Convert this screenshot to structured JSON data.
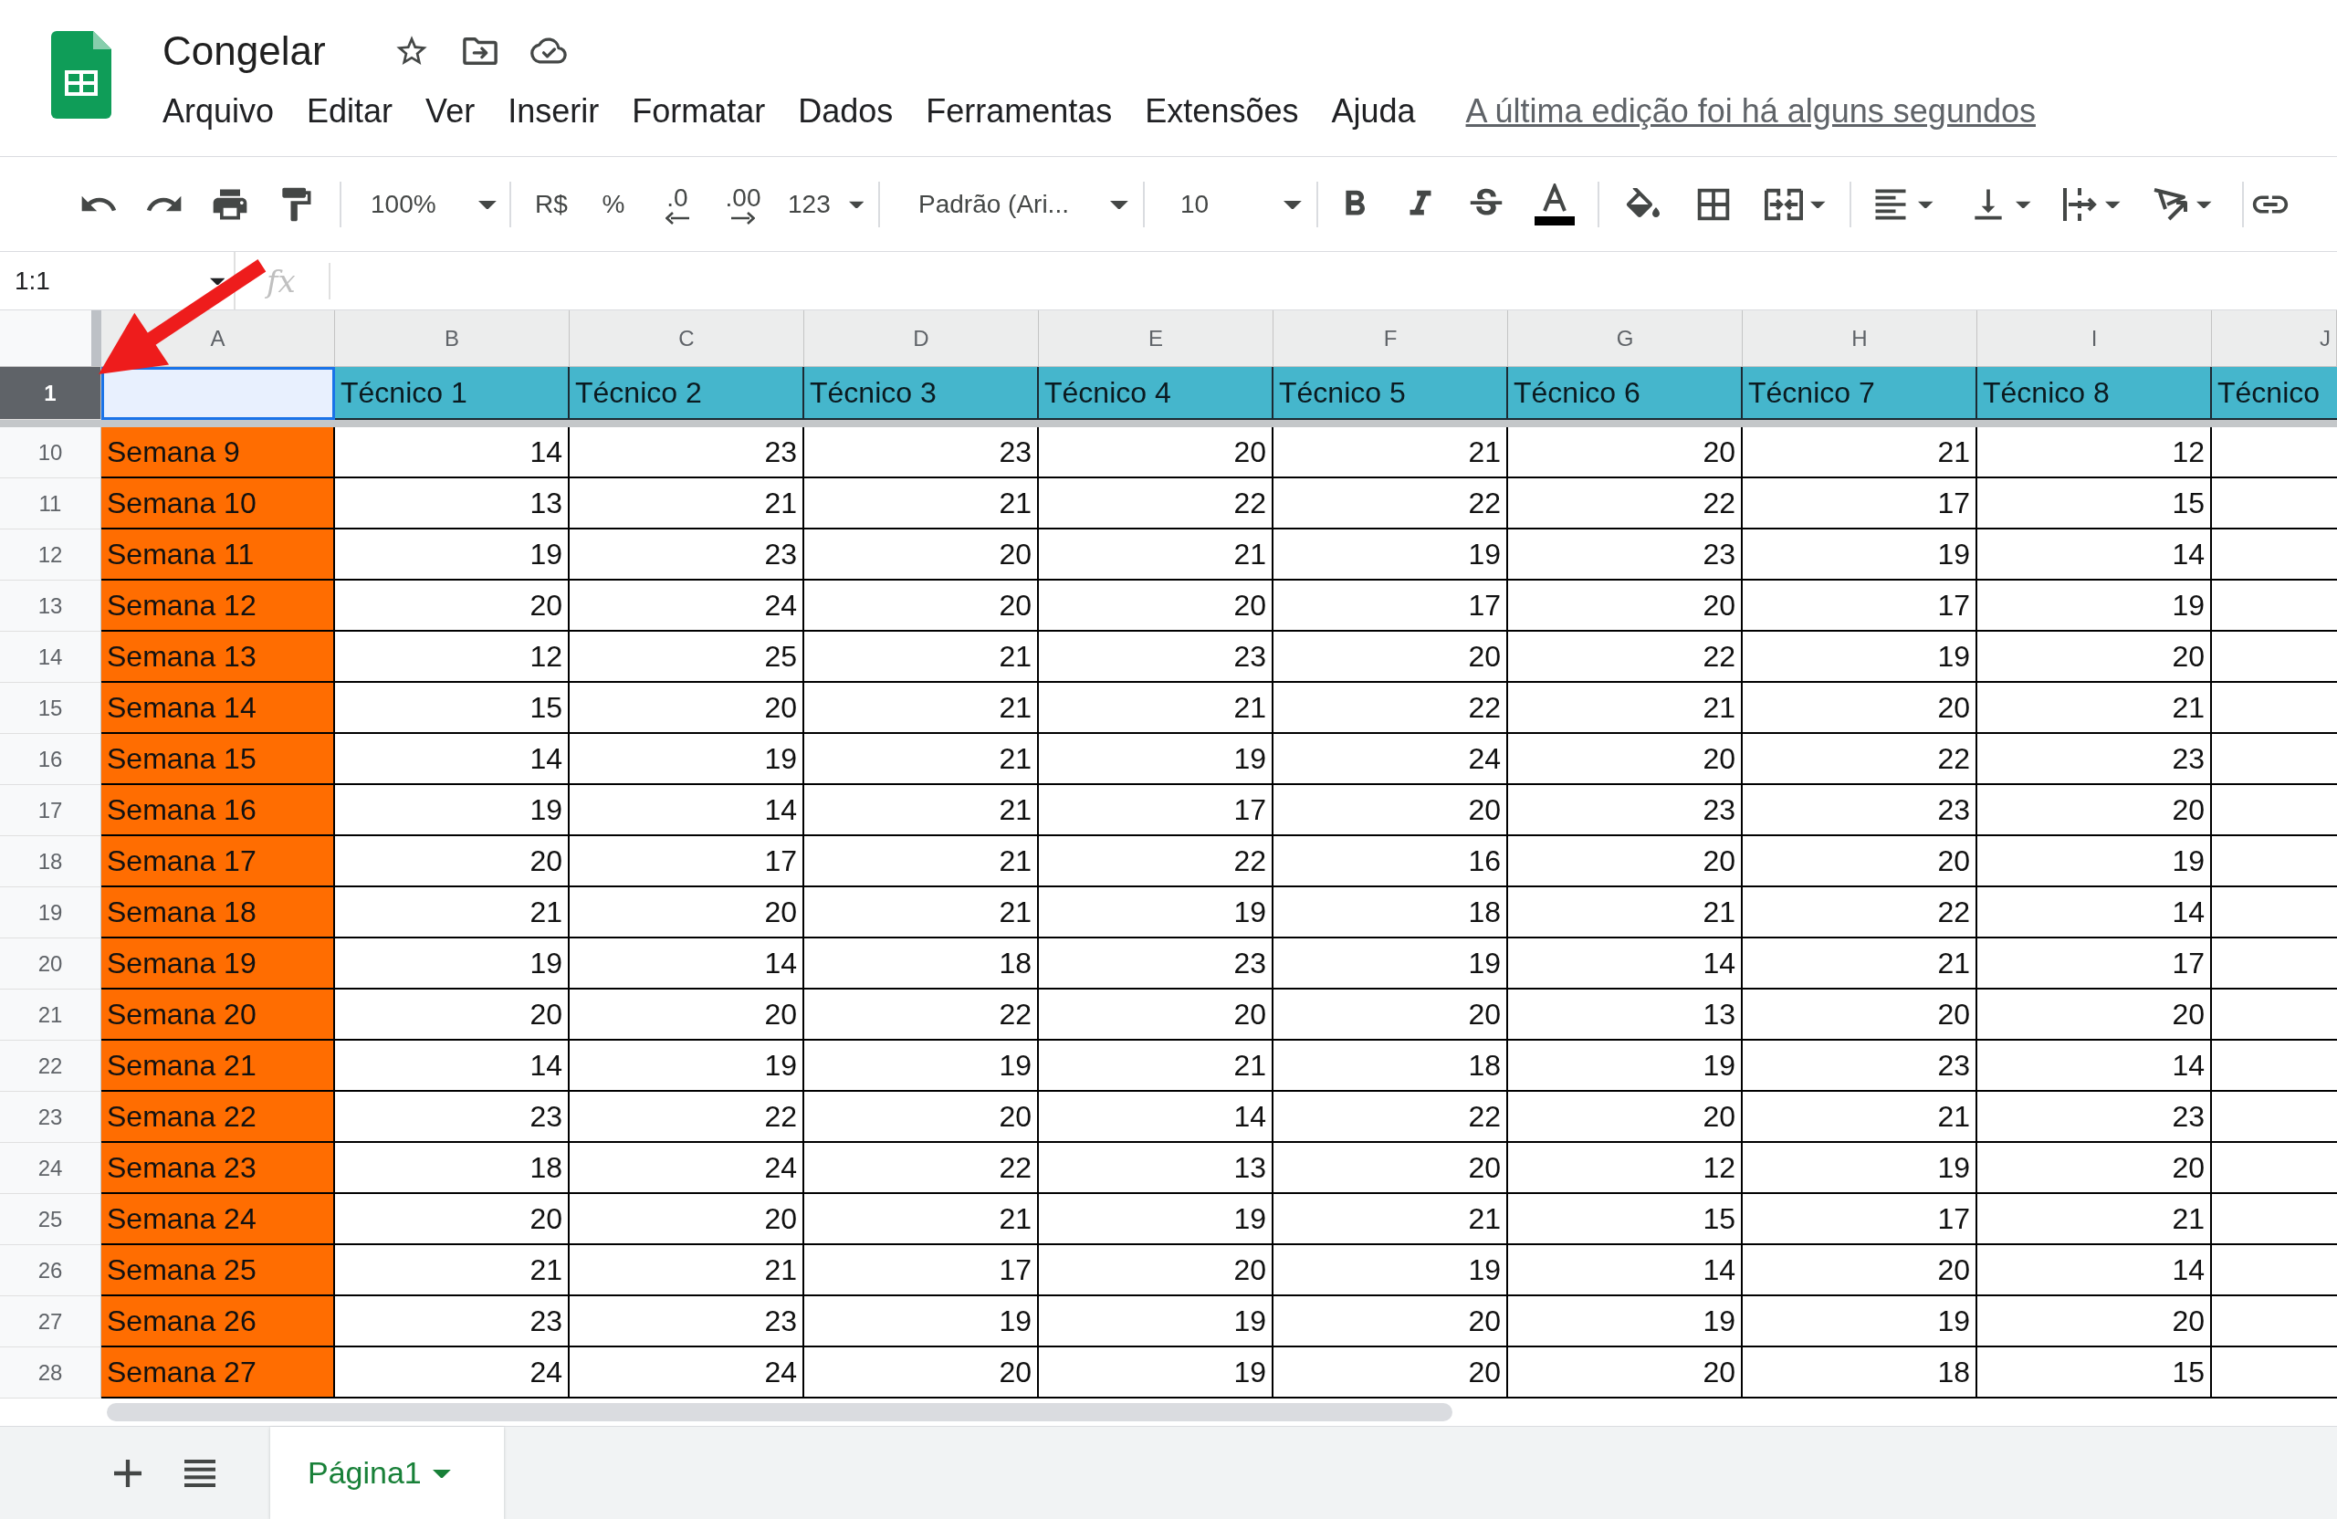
{
  "document": {
    "title": "Congelar",
    "menu": [
      "Arquivo",
      "Editar",
      "Ver",
      "Inserir",
      "Formatar",
      "Dados",
      "Ferramentas",
      "Extensões",
      "Ajuda"
    ],
    "last_edit": "A última edição foi há alguns segundos"
  },
  "toolbar": {
    "zoom": "100%",
    "currency": "R$",
    "percent": "%",
    "decrease_decimals": ".0",
    "increase_decimals": ".00",
    "more_formats": "123",
    "font": "Padrão (Ari...",
    "font_size": "10"
  },
  "formula_bar": {
    "name_box": "1:1",
    "function_label": "fx"
  },
  "grid": {
    "columns": [
      "A",
      "B",
      "C",
      "D",
      "E",
      "F",
      "G",
      "H",
      "I",
      "J"
    ],
    "frozen_row": {
      "number": "1",
      "selected": true,
      "cells": [
        {
          "active": true
        },
        {
          "text": "Técnico 1",
          "active": false
        },
        {
          "text": "Técnico 2",
          "active": false
        },
        {
          "text": "Técnico 3",
          "active": false
        },
        {
          "text": "Técnico 4",
          "active": false
        },
        {
          "text": "Técnico 5",
          "active": false
        },
        {
          "text": "Técnico 6",
          "active": false
        },
        {
          "text": "Técnico 7",
          "active": false
        },
        {
          "text": "Técnico 8",
          "active": false
        },
        {
          "text": "Técnico",
          "active": false
        }
      ]
    },
    "rows": [
      {
        "number": "10",
        "selected": false,
        "week": "Semana 9",
        "values": [
          "14",
          "23",
          "23",
          "20",
          "21",
          "20",
          "21",
          "12"
        ]
      },
      {
        "number": "11",
        "selected": false,
        "week": "Semana 10",
        "values": [
          "13",
          "21",
          "21",
          "22",
          "22",
          "22",
          "17",
          "15"
        ]
      },
      {
        "number": "12",
        "selected": false,
        "week": "Semana 11",
        "values": [
          "19",
          "23",
          "20",
          "21",
          "19",
          "23",
          "19",
          "14"
        ]
      },
      {
        "number": "13",
        "selected": false,
        "week": "Semana 12",
        "values": [
          "20",
          "24",
          "20",
          "20",
          "17",
          "20",
          "17",
          "19"
        ]
      },
      {
        "number": "14",
        "selected": false,
        "week": "Semana 13",
        "values": [
          "12",
          "25",
          "21",
          "23",
          "20",
          "22",
          "19",
          "20"
        ]
      },
      {
        "number": "15",
        "selected": false,
        "week": "Semana 14",
        "values": [
          "15",
          "20",
          "21",
          "21",
          "22",
          "21",
          "20",
          "21"
        ]
      },
      {
        "number": "16",
        "selected": false,
        "week": "Semana 15",
        "values": [
          "14",
          "19",
          "21",
          "19",
          "24",
          "20",
          "22",
          "23"
        ]
      },
      {
        "number": "17",
        "selected": false,
        "week": "Semana 16",
        "values": [
          "19",
          "14",
          "21",
          "17",
          "20",
          "23",
          "23",
          "20"
        ]
      },
      {
        "number": "18",
        "selected": false,
        "week": "Semana 17",
        "values": [
          "20",
          "17",
          "21",
          "22",
          "16",
          "20",
          "20",
          "19"
        ]
      },
      {
        "number": "19",
        "selected": false,
        "week": "Semana 18",
        "values": [
          "21",
          "20",
          "21",
          "19",
          "18",
          "21",
          "22",
          "14"
        ]
      },
      {
        "number": "20",
        "selected": false,
        "week": "Semana 19",
        "values": [
          "19",
          "14",
          "18",
          "23",
          "19",
          "14",
          "21",
          "17"
        ]
      },
      {
        "number": "21",
        "selected": false,
        "week": "Semana 20",
        "values": [
          "20",
          "20",
          "22",
          "20",
          "20",
          "13",
          "20",
          "20"
        ]
      },
      {
        "number": "22",
        "selected": false,
        "week": "Semana 21",
        "values": [
          "14",
          "19",
          "19",
          "21",
          "18",
          "19",
          "23",
          "14"
        ]
      },
      {
        "number": "23",
        "selected": false,
        "week": "Semana 22",
        "values": [
          "23",
          "22",
          "20",
          "14",
          "22",
          "20",
          "21",
          "23"
        ]
      },
      {
        "number": "24",
        "selected": false,
        "week": "Semana 23",
        "values": [
          "18",
          "24",
          "22",
          "13",
          "20",
          "12",
          "19",
          "20"
        ]
      },
      {
        "number": "25",
        "selected": false,
        "week": "Semana 24",
        "values": [
          "20",
          "20",
          "21",
          "19",
          "21",
          "15",
          "17",
          "21"
        ]
      },
      {
        "number": "26",
        "selected": false,
        "week": "Semana 25",
        "values": [
          "21",
          "21",
          "17",
          "20",
          "19",
          "14",
          "20",
          "14"
        ]
      },
      {
        "number": "27",
        "selected": false,
        "week": "Semana 26",
        "values": [
          "23",
          "23",
          "19",
          "19",
          "20",
          "19",
          "19",
          "20"
        ]
      },
      {
        "number": "28",
        "selected": false,
        "week": "Semana 27",
        "values": [
          "24",
          "24",
          "20",
          "19",
          "20",
          "20",
          "18",
          "15"
        ]
      }
    ]
  },
  "sheet_tabs": [
    {
      "label": "Página1",
      "selected": true
    }
  ]
}
